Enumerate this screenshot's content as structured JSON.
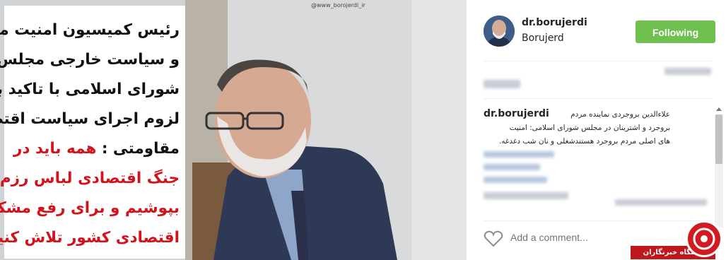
{
  "post": {
    "watermark": "@www_borojerdi_ir",
    "headline_lines": [
      {
        "text": "رئیس کمیسیون امنیت ملی",
        "color": "#111111"
      },
      {
        "text": "و سیاست خارجی مجلس",
        "color": "#111111"
      },
      {
        "text": "شورای اسلامی با تاکید بر",
        "color": "#111111"
      },
      {
        "text": "لزوم اجرای سیاست اقتصاد",
        "color": "#111111"
      },
      {
        "text": "مقاومتی : ",
        "highlight": "همه باید در",
        "color": "#111111"
      },
      {
        "text": "جنگ اقتصادی لباس رزم",
        "color": "#d3121b"
      },
      {
        "text": "بپوشیم و برای رفع مشکلات",
        "color": "#d3121b"
      },
      {
        "text": "اقتصادی کشور تلاش کنیم.",
        "color": "#d3121b"
      }
    ]
  },
  "header": {
    "username": "dr.borujerdi",
    "location": "Borujerd",
    "follow_label": "Following",
    "follow_color": "#70c050"
  },
  "caption": {
    "username": "dr.borujerdi",
    "text_line1": "علاءالدین بروجردی نماینده مردم",
    "text_line2": "بروجرد و اشترینان در مجلس شورای اسلامی: امنیت",
    "text_line3": "های اصلی مردم بروجرد هستندشغلی و نان شب دغدغه."
  },
  "footer": {
    "comment_placeholder": "Add a comment..."
  },
  "badge": {
    "text": "باشگاه خبرنگاران"
  }
}
